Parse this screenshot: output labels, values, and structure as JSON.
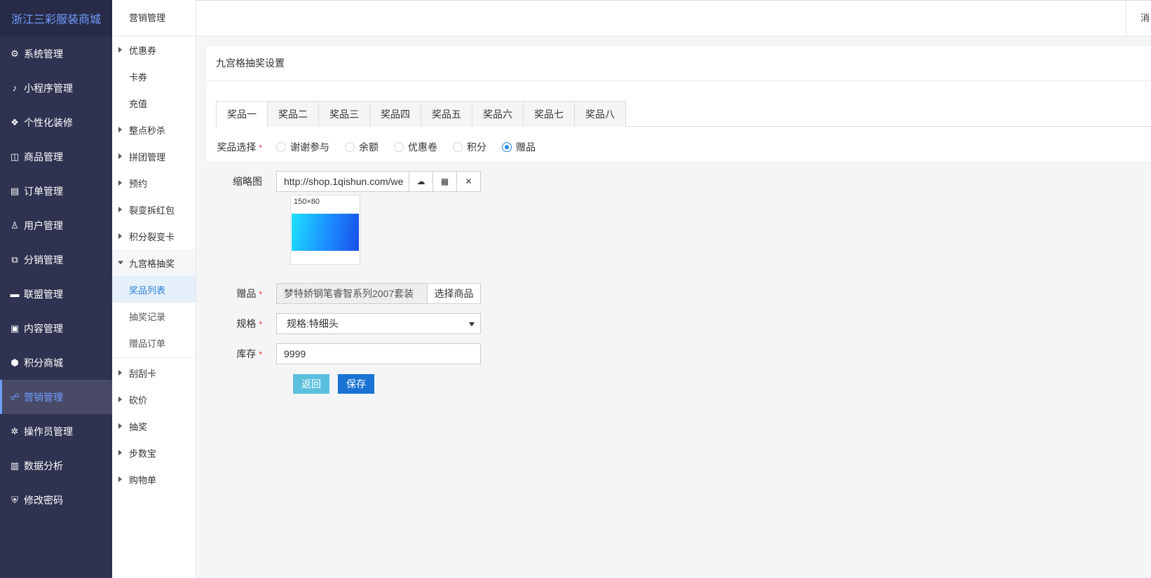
{
  "sidebar": {
    "brand": "浙江三彩服装商城",
    "items": [
      {
        "label": "系统管理",
        "icon": "⚙"
      },
      {
        "label": "小程序管理",
        "icon": "♪"
      },
      {
        "label": "个性化装修",
        "icon": "❖"
      },
      {
        "label": "商品管理",
        "icon": "◫"
      },
      {
        "label": "订单管理",
        "icon": "▤"
      },
      {
        "label": "用户管理",
        "icon": "♙"
      },
      {
        "label": "分销管理",
        "icon": "⧉"
      },
      {
        "label": "联盟管理",
        "icon": "▬"
      },
      {
        "label": "内容管理",
        "icon": "▣"
      },
      {
        "label": "积分商城",
        "icon": "⬢"
      },
      {
        "label": "营销管理",
        "icon": "☍"
      },
      {
        "label": "操作员管理",
        "icon": "✲"
      },
      {
        "label": "数据分析",
        "icon": "▥"
      },
      {
        "label": "修改密码",
        "icon": "⛨"
      }
    ]
  },
  "submenu": {
    "title": "营销管理",
    "items": [
      {
        "label": "优惠券"
      },
      {
        "label": "卡券"
      },
      {
        "label": "充值"
      },
      {
        "label": "整点秒杀"
      },
      {
        "label": "拼团管理"
      },
      {
        "label": "预约"
      },
      {
        "label": "裂变拆红包"
      },
      {
        "label": "积分裂变卡"
      },
      {
        "label": "九宫格抽奖"
      },
      {
        "label": "奖品列表"
      },
      {
        "label": "抽奖记录"
      },
      {
        "label": "赠品订单"
      },
      {
        "label": "刮刮卡"
      },
      {
        "label": "砍价"
      },
      {
        "label": "抽奖"
      },
      {
        "label": "步数宝"
      },
      {
        "label": "购物单"
      }
    ]
  },
  "topbar": {
    "message_label": "消"
  },
  "panel": {
    "title": "九宫格抽奖设置"
  },
  "tabs": [
    "奖品一",
    "奖品二",
    "奖品三",
    "奖品四",
    "奖品五",
    "奖品六",
    "奖品七",
    "奖品八"
  ],
  "form": {
    "prize_type": {
      "label": "奖品选择",
      "options": [
        "谢谢参与",
        "余额",
        "优惠卷",
        "积分",
        "赠品"
      ],
      "selected": "赠品"
    },
    "thumbnail": {
      "label": "缩略图",
      "value": "http://shop.1qishun.com/we",
      "size_hint": "150×80",
      "upload_icon": "☁",
      "grid_icon": "▦",
      "clear_icon": "✕"
    },
    "gift": {
      "label": "赠品",
      "value": "梦特娇钢笔睿智系列2007套装",
      "button": "选择商品"
    },
    "spec": {
      "label": "规格",
      "value": "规格:特细头"
    },
    "stock": {
      "label": "库存",
      "value": "9999"
    },
    "back_button": "返回",
    "save_button": "保存",
    "required_mark": "*"
  }
}
